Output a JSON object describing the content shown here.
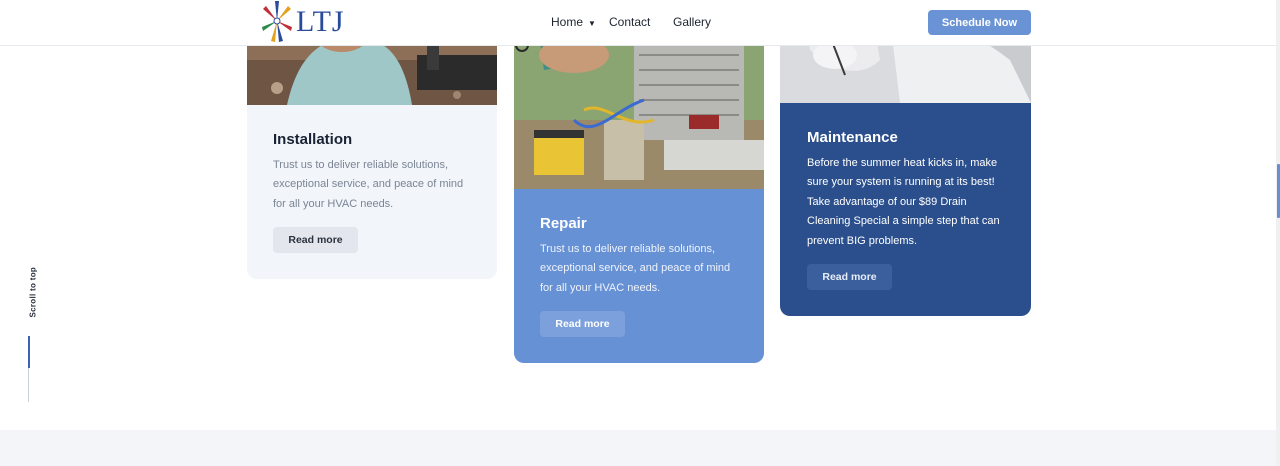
{
  "brand": {
    "name": "LTJ",
    "accent": "#6a93d6",
    "dark": "#2a4f8c"
  },
  "nav": {
    "home": "Home",
    "contact": "Contact",
    "gallery": "Gallery",
    "cta": "Schedule Now"
  },
  "scroll_to_top": "Scroll to top",
  "services": [
    {
      "title": "Installation",
      "description": "Trust us to deliver reliable solutions, exceptional service, and peace of mind for all your HVAC needs.",
      "button": "Read more"
    },
    {
      "title": "Repair",
      "description": "Trust us to deliver reliable solutions, exceptional service, and peace of mind for all your HVAC needs.",
      "button": "Read more"
    },
    {
      "title": "Maintenance",
      "description": "Before the summer heat kicks in, make sure your system is running at its best! Take advantage of our $89 Drain Cleaning Special a simple step that can prevent BIG problems.",
      "button": "Read more"
    }
  ]
}
